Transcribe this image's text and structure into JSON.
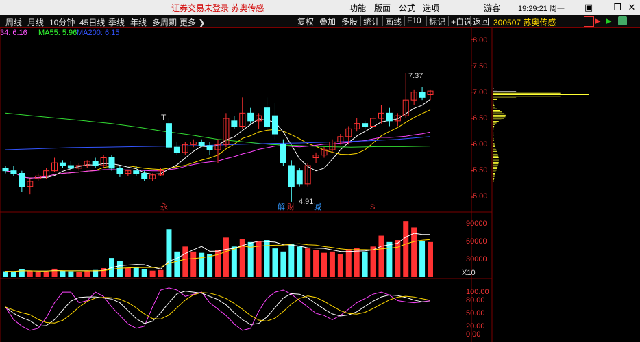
{
  "window": {
    "title": "证券交易未登录  苏奥传感",
    "menu": [
      "功能",
      "版面",
      "公式",
      "选项"
    ],
    "user": "游客",
    "clock": "19:29:21 周一",
    "colors": {
      "title": "#d20000",
      "accent": "#ffd800"
    }
  },
  "toolbar": {
    "periods": [
      "周线",
      "月线",
      "10分钟",
      "45日线",
      "季线",
      "年线",
      "多周期",
      "更多"
    ],
    "buttons": [
      "复权",
      "叠加",
      "多股",
      "统计",
      "画线",
      "F10",
      "标记",
      "+自选",
      "返回"
    ],
    "stock_label": "300507  苏奥传感"
  },
  "legend": {
    "ma_left": "34: 6.16",
    "ma55": "MA55: 5.96",
    "ma200": "MA200: 6.15"
  },
  "price_axis": {
    "ticks": [
      "8.00",
      "7.50",
      "7.00",
      "6.50",
      "6.00",
      "5.50",
      "5.00"
    ]
  },
  "annotations": {
    "high": "7.37",
    "low": "4.91",
    "t_marker": "T",
    "events": [
      "永",
      "解",
      "财",
      "减",
      "S"
    ]
  },
  "volume_axis": {
    "ticks": [
      "90000",
      "60000",
      "30000"
    ],
    "unit": "X10"
  },
  "indicator_axis": {
    "ticks": [
      "100.00",
      "80.00",
      "50.00",
      "20.00",
      "0.00"
    ]
  },
  "chart_data": {
    "type": "candlestick",
    "ylim": [
      4.8,
      8.2
    ],
    "candles": [
      [
        5.55,
        5.6,
        5.45,
        5.5
      ],
      [
        5.5,
        5.6,
        5.4,
        5.45
      ],
      [
        5.45,
        5.5,
        5.1,
        5.2
      ],
      [
        5.2,
        5.35,
        5.05,
        5.3
      ],
      [
        5.35,
        5.45,
        5.3,
        5.4
      ],
      [
        5.4,
        5.55,
        5.35,
        5.5
      ],
      [
        5.5,
        5.75,
        5.48,
        5.65
      ],
      [
        5.65,
        5.7,
        5.55,
        5.6
      ],
      [
        5.6,
        5.68,
        5.5,
        5.55
      ],
      [
        5.55,
        5.65,
        5.5,
        5.6
      ],
      [
        5.6,
        5.7,
        5.55,
        5.68
      ],
      [
        5.68,
        5.75,
        5.55,
        5.6
      ],
      [
        5.6,
        5.8,
        5.55,
        5.75
      ],
      [
        5.75,
        5.8,
        5.5,
        5.55
      ],
      [
        5.55,
        5.6,
        5.38,
        5.45
      ],
      [
        5.45,
        5.52,
        5.4,
        5.5
      ],
      [
        5.5,
        5.6,
        5.4,
        5.45
      ],
      [
        5.45,
        5.5,
        5.3,
        5.35
      ],
      [
        5.35,
        5.45,
        5.3,
        5.42
      ],
      [
        5.42,
        5.55,
        5.4,
        5.5
      ],
      [
        6.4,
        6.5,
        5.9,
        5.95
      ],
      [
        5.95,
        6.05,
        5.8,
        5.85
      ],
      [
        5.85,
        6.05,
        5.8,
        6.0
      ],
      [
        6.0,
        6.1,
        5.95,
        6.05
      ],
      [
        6.05,
        6.1,
        5.95,
        5.98
      ],
      [
        5.98,
        6.05,
        5.8,
        5.9
      ],
      [
        5.9,
        6.1,
        5.65,
        6.0
      ],
      [
        6.0,
        6.6,
        5.95,
        6.5
      ],
      [
        6.45,
        6.55,
        6.3,
        6.35
      ],
      [
        6.35,
        6.9,
        6.3,
        6.6
      ],
      [
        6.6,
        6.7,
        6.4,
        6.45
      ],
      [
        6.45,
        6.6,
        6.3,
        6.55
      ],
      [
        6.7,
        6.9,
        6.3,
        6.35
      ],
      [
        6.55,
        6.8,
        6.1,
        6.2
      ],
      [
        6.0,
        6.1,
        5.6,
        5.65
      ],
      [
        5.6,
        5.7,
        4.91,
        5.2
      ],
      [
        5.5,
        5.55,
        5.2,
        5.25
      ],
      [
        5.25,
        5.65,
        5.2,
        5.6
      ],
      [
        5.75,
        5.85,
        5.65,
        5.8
      ],
      [
        5.8,
        5.95,
        5.75,
        5.9
      ],
      [
        5.9,
        6.1,
        5.85,
        6.05
      ],
      [
        6.05,
        6.2,
        6.0,
        6.15
      ],
      [
        6.15,
        6.35,
        6.0,
        6.3
      ],
      [
        6.3,
        6.5,
        6.25,
        6.4
      ],
      [
        6.4,
        6.45,
        6.3,
        6.35
      ],
      [
        6.35,
        6.55,
        6.3,
        6.5
      ],
      [
        6.5,
        6.75,
        6.4,
        6.6
      ],
      [
        6.6,
        6.7,
        6.35,
        6.45
      ],
      [
        6.45,
        6.6,
        6.35,
        6.55
      ],
      [
        6.55,
        7.37,
        6.5,
        6.85
      ],
      [
        6.85,
        7.05,
        6.75,
        7.0
      ],
      [
        7.0,
        7.1,
        6.85,
        6.9
      ],
      [
        6.95,
        7.05,
        6.85,
        7.02
      ]
    ],
    "volume": [
      9000,
      8500,
      12000,
      9500,
      8000,
      9000,
      13000,
      10000,
      9000,
      8500,
      9500,
      11000,
      14000,
      30000,
      25000,
      14000,
      16000,
      12000,
      10000,
      11000,
      75000,
      40000,
      48000,
      40000,
      38000,
      36000,
      42000,
      62000,
      48000,
      60000,
      55000,
      57000,
      58000,
      45000,
      40000,
      52000,
      48000,
      45000,
      42000,
      38000,
      40000,
      36000,
      44000,
      46000,
      40000,
      48000,
      65000,
      55000,
      58000,
      88000,
      78000,
      56000,
      55000
    ]
  }
}
